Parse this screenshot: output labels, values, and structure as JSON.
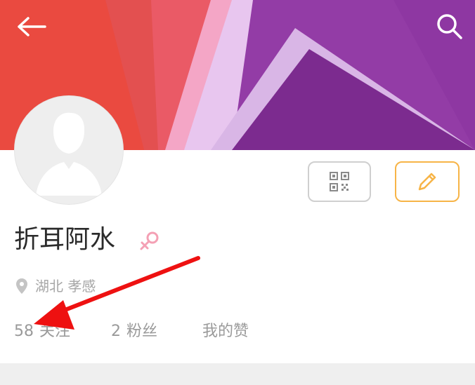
{
  "header": {
    "back_icon": "arrow-left-icon",
    "search_icon": "search-icon"
  },
  "banner": {
    "colors": [
      "#e8483f",
      "#e05656",
      "#ee5a6f",
      "#f0a7c6",
      "#e7c3ee",
      "#c9a7d8",
      "#8f3aa3",
      "#7a2a8e",
      "#9a3fb1"
    ]
  },
  "profile": {
    "username": "折耳阿水",
    "gender_icon": "female-symbol-icon",
    "location_icon": "map-pin-icon",
    "location": "湖北 孝感",
    "avatar_icon": "default-avatar-icon"
  },
  "actions": {
    "qr_icon": "qr-code-icon",
    "edit_icon": "pencil-icon",
    "edit_color": "#f7b447"
  },
  "stats": {
    "following_count": "58",
    "following_label": "关注",
    "fans_count": "2",
    "fans_label": "粉丝",
    "likes_label": "我的赞"
  },
  "annotation": {
    "type": "red-arrow",
    "color": "#ee1111",
    "target": "following-stat"
  }
}
